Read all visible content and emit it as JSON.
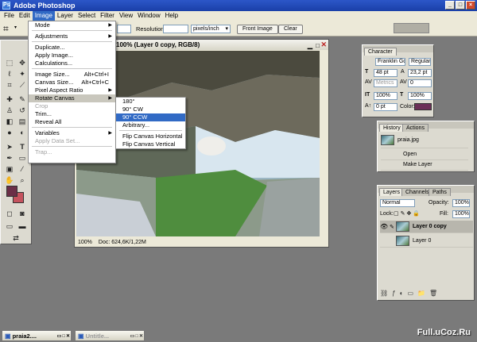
{
  "window": {
    "title": "Adobe Photoshop"
  },
  "menubar": [
    "File",
    "Edit",
    "Image",
    "Layer",
    "Select",
    "Filter",
    "View",
    "Window",
    "Help"
  ],
  "options": {
    "resolution_label": "Resolution:",
    "resolution_unit": "pixels/inch",
    "front_image": "Front Image",
    "clear": "Clear"
  },
  "document": {
    "title": "100% (Layer 0 copy, RGB/8)",
    "zoom": "100%",
    "doc_info": "Doc: 624,6K/1,22M"
  },
  "image_menu": [
    {
      "label": "Mode",
      "arrow": true
    },
    {
      "sep": true
    },
    {
      "label": "Adjustments",
      "arrow": true
    },
    {
      "sep": true
    },
    {
      "label": "Duplicate..."
    },
    {
      "label": "Apply Image..."
    },
    {
      "label": "Calculations..."
    },
    {
      "sep": true
    },
    {
      "label": "Image Size...",
      "shortcut": "Alt+Ctrl+I"
    },
    {
      "label": "Canvas Size...",
      "shortcut": "Alt+Ctrl+C"
    },
    {
      "label": "Pixel Aspect Ratio",
      "arrow": true
    },
    {
      "label": "Rotate Canvas",
      "arrow": true,
      "highlight": true
    },
    {
      "label": "Crop",
      "disabled": true
    },
    {
      "label": "Trim..."
    },
    {
      "label": "Reveal All"
    },
    {
      "sep": true
    },
    {
      "label": "Variables",
      "arrow": true
    },
    {
      "label": "Apply Data Set...",
      "disabled": true
    },
    {
      "sep": true
    },
    {
      "label": "Trap...",
      "disabled": true
    }
  ],
  "rotate_menu": [
    {
      "label": "180°"
    },
    {
      "label": "90° CW"
    },
    {
      "label": "90° CCW",
      "selected": true
    },
    {
      "label": "Arbitrary..."
    },
    {
      "sep": true
    },
    {
      "label": "Flip Canvas Horizontal"
    },
    {
      "label": "Flip Canvas Vertical"
    }
  ],
  "character": {
    "tab": "Character",
    "font": "Franklin Gothic D...",
    "style": "Regular",
    "size": "48 pt",
    "leading": "23,2 pt",
    "kerning": "Metrics",
    "tracking": "0",
    "vscale": "100%",
    "hscale": "100%",
    "baseline": "0 pt",
    "color_label": "Color:",
    "color": "#6b2f57"
  },
  "history": {
    "tabs": [
      "History",
      "Actions"
    ],
    "items": [
      "praia.jpg",
      "Open",
      "Make Layer"
    ]
  },
  "layers": {
    "tabs": [
      "Layers",
      "Channels",
      "Paths"
    ],
    "blend": "Normal",
    "opacity_label": "Opacity:",
    "opacity": "100%",
    "lock_label": "Lock:",
    "fill_label": "Fill:",
    "fill": "100%",
    "items": [
      {
        "name": "Layer 0 copy",
        "active": true
      },
      {
        "name": "Layer 0"
      }
    ]
  },
  "taskbar": [
    "praia2....",
    "Untitle..."
  ],
  "colors": {
    "foreground": "#6b2f47",
    "background": "#c5535e"
  },
  "watermark": "Full.uCoz.Ru"
}
